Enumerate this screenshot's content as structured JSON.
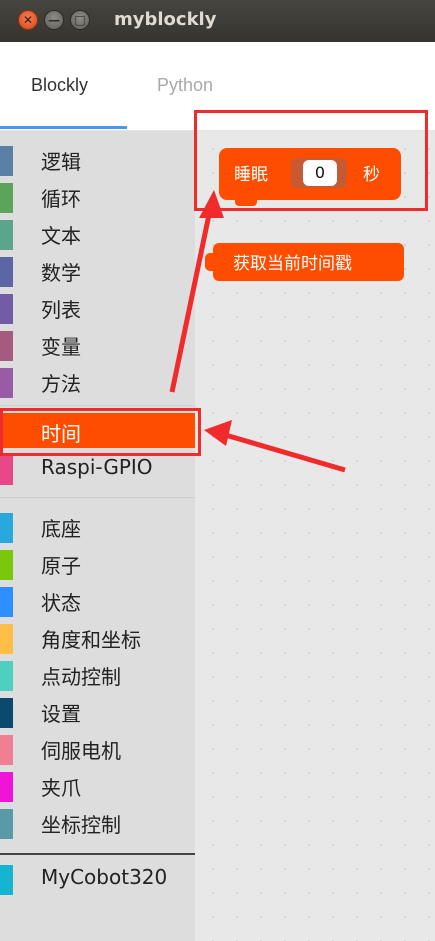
{
  "window": {
    "title": "myblockly",
    "close_glyph": "✕",
    "min_glyph": "—",
    "max_glyph": "□"
  },
  "tabs": [
    {
      "label": "Blockly",
      "active": true
    },
    {
      "label": "Python",
      "active": false
    }
  ],
  "toolbox": {
    "categories": [
      {
        "label": "逻辑",
        "color": "#5b80a5"
      },
      {
        "label": "循环",
        "color": "#5ba55b"
      },
      {
        "label": "文本",
        "color": "#5ba58c"
      },
      {
        "label": "数学",
        "color": "#5b67a5"
      },
      {
        "label": "列表",
        "color": "#745ba5"
      },
      {
        "label": "变量",
        "color": "#a55b80"
      },
      {
        "label": "方法",
        "color": "#995ba5"
      },
      {
        "label": "时间",
        "color": "#ff4d00",
        "selected": true
      },
      {
        "label": "Raspi-GPIO",
        "color": "#e8488a"
      },
      {
        "label": "底座",
        "color": "#29a8e0"
      },
      {
        "label": "原子",
        "color": "#7ac80e"
      },
      {
        "label": "状态",
        "color": "#2e8fff"
      },
      {
        "label": "角度和坐标",
        "color": "#ffbf47"
      },
      {
        "label": "点动控制",
        "color": "#4fcfbe"
      },
      {
        "label": "设置",
        "color": "#0b4a6e"
      },
      {
        "label": "伺服电机",
        "color": "#f07f94"
      },
      {
        "label": "夹爪",
        "color": "#f014d8"
      },
      {
        "label": "坐标控制",
        "color": "#5a9aa8"
      },
      {
        "label": "MyCobot320",
        "color": "#15b5cf"
      }
    ]
  },
  "flyout": {
    "sleep_block": {
      "label": "睡眠",
      "value": "0",
      "unit": "秒"
    },
    "timestamp_block": {
      "label": "获取当前时间戳"
    }
  },
  "colors": {
    "accent": "#4c97e8",
    "block": "#ff4d00",
    "annotation": "#ef2b2b"
  }
}
